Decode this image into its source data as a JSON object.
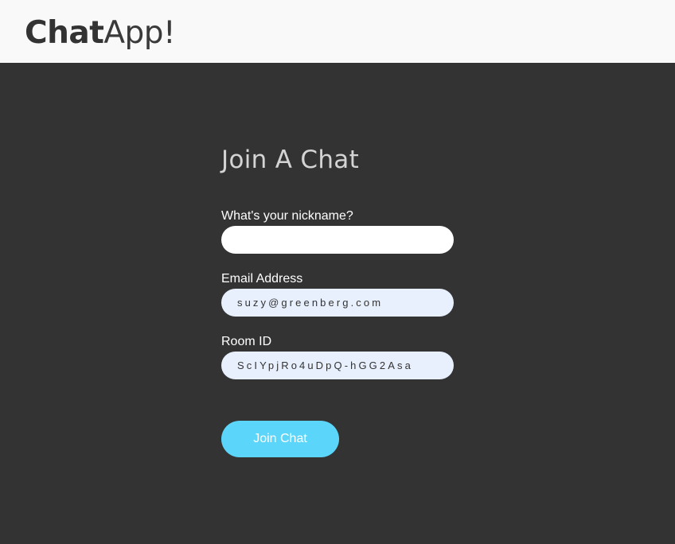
{
  "header": {
    "logo_bold": "Chat",
    "logo_light": "App!"
  },
  "form": {
    "title": "Join A Chat",
    "nickname": {
      "label": "What's your nickname?",
      "value": ""
    },
    "email": {
      "label": "Email Address",
      "value": "suzy@greenberg.com"
    },
    "room": {
      "label": "Room ID",
      "value": "ScIYpjRo4uDpQ-hGG2Asa"
    },
    "submit_label": "Join Chat"
  },
  "colors": {
    "background": "#333333",
    "header_background": "#f9f9f9",
    "accent": "#5bd6fa",
    "autofill_background": "#e8f0fe"
  }
}
